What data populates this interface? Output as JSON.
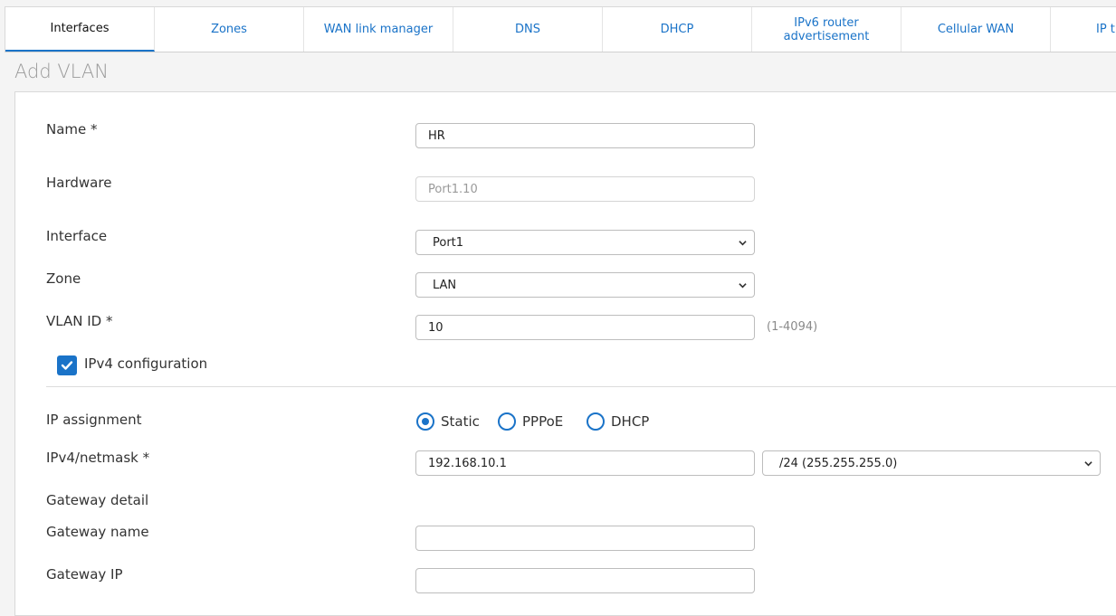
{
  "tabs": [
    {
      "label": "Interfaces",
      "active": true
    },
    {
      "label": "Zones"
    },
    {
      "label": "WAN link manager"
    },
    {
      "label": "DNS"
    },
    {
      "label": "DHCP"
    },
    {
      "label": "IPv6 router advertisement"
    },
    {
      "label": "Cellular WAN"
    },
    {
      "label": "IP t"
    }
  ],
  "page_title": "Add VLAN",
  "form": {
    "name_label": "Name *",
    "name_value": "HR",
    "hardware_label": "Hardware",
    "hardware_value": "Port1.10",
    "interface_label": "Interface",
    "interface_value": "Port1",
    "zone_label": "Zone",
    "zone_value": "LAN",
    "vlan_label": "VLAN ID *",
    "vlan_value": "10",
    "vlan_hint": "(1-4094)",
    "ipv4_config_label": "IPv4 configuration",
    "ipv4_config_checked": true,
    "ip_assignment_label": "IP assignment",
    "ip_assignment_options": [
      "Static",
      "PPPoE",
      "DHCP"
    ],
    "ip_assignment_selected": "Static",
    "netmask_label": "IPv4/netmask *",
    "ipv4_value": "192.168.10.1",
    "netmask_value": "/24 (255.255.255.0)",
    "gateway_detail_label": "Gateway detail",
    "gateway_name_label": "Gateway name",
    "gateway_name_value": "",
    "gateway_ip_label": "Gateway IP",
    "gateway_ip_value": ""
  },
  "colors": {
    "accent": "#1a73c8"
  }
}
